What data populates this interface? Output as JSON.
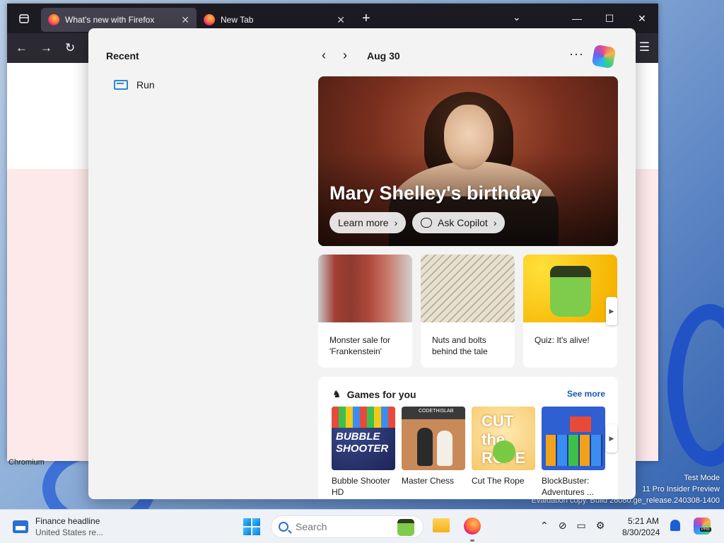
{
  "browser": {
    "tabs": [
      {
        "title": "What's new with Firefox",
        "active": true
      },
      {
        "title": "New Tab",
        "active": false
      }
    ],
    "new_tab_symbol": "+",
    "chromium_label": "Chromium"
  },
  "widgets": {
    "recent_title": "Recent",
    "recent_items": [
      {
        "label": "Run",
        "icon": "run-icon"
      }
    ],
    "date": "Aug 30",
    "hero": {
      "title": "Mary Shelley's birthday",
      "learn_more": "Learn more",
      "ask_copilot": "Ask Copilot"
    },
    "cards": [
      {
        "title": "Monster sale for 'Frankenstein'"
      },
      {
        "title": "Nuts and bolts behind the tale"
      },
      {
        "title": "Quiz: It's alive!"
      }
    ],
    "games": {
      "title": "Games for you",
      "see_more": "See more",
      "items": [
        {
          "name": "Bubble Shooter HD",
          "art_text": "BUBBLE SHOOTER"
        },
        {
          "name": "Master Chess",
          "art_text": "CODETHISLAB"
        },
        {
          "name": "Cut The Rope",
          "art_text": "CUT the ROPE"
        },
        {
          "name": "BlockBuster: Adventures ..."
        }
      ]
    }
  },
  "taskbar": {
    "widget_title": "Finance headline",
    "widget_subtitle": "United States re...",
    "search_placeholder": "Search",
    "time": "5:21 AM",
    "date": "8/30/2024",
    "copilot_badge": "PRE"
  },
  "watermark": {
    "line1": "Test Mode",
    "line2": "11 Pro Insider Preview",
    "line3": "Evaluation copy. Build 26080.ge_release.240308-1400"
  },
  "colors": {
    "accent": "#0f5bb5",
    "browser_dark": "#1c1b22",
    "panel_bg": "#f3f3f3"
  }
}
